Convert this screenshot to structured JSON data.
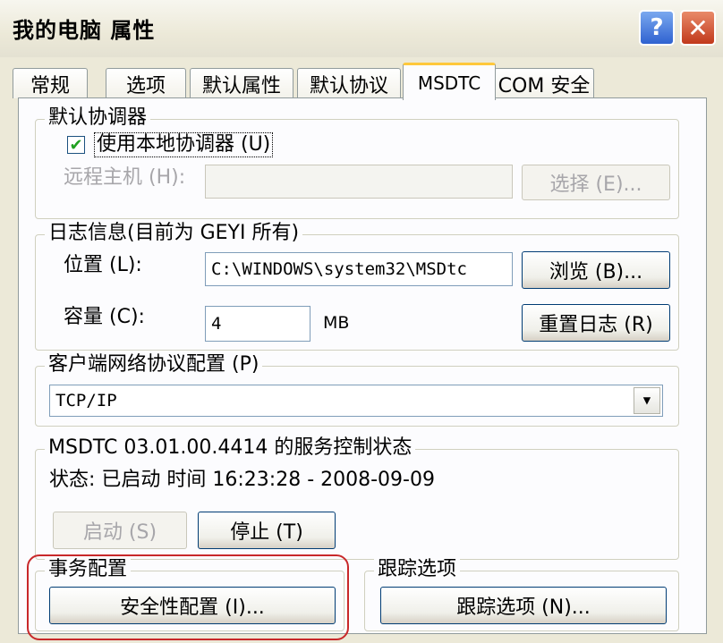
{
  "window": {
    "title": "我的电脑 属性",
    "help_glyph": "?",
    "close_glyph": "✕"
  },
  "tabs": [
    {
      "label": "常规"
    },
    {
      "label": "选项"
    },
    {
      "label": "默认属性"
    },
    {
      "label": "默认协议"
    },
    {
      "label": "MSDTC"
    },
    {
      "label": "COM 安全"
    }
  ],
  "coordinator": {
    "legend": "默认协调器",
    "use_local_label": "使用本地协调器 (U)",
    "use_local_checked": true,
    "remote_host_label": "远程主机 (H):",
    "remote_host_value": "",
    "select_button": "选择 (E)..."
  },
  "log": {
    "legend": "日志信息(目前为 GEYI 所有)",
    "location_label": "位置 (L):",
    "location_value": "C:\\WINDOWS\\system32\\MSDtc",
    "browse_button": "浏览 (B)...",
    "capacity_label": "容量 (C):",
    "capacity_value": "4",
    "capacity_unit": "MB",
    "reset_button": "重置日志 (R)"
  },
  "client_protocol": {
    "legend": "客户端网络协议配置 (P)",
    "selected": "TCP/IP"
  },
  "service": {
    "legend": "MSDTC 03.01.00.4414 的服务控制状态",
    "status_text": "状态: 已启动 时间 16:23:28 - 2008-09-09",
    "start_button": "启动 (S)",
    "stop_button": "停止 (T)"
  },
  "transaction": {
    "legend": "事务配置",
    "security_button": "安全性配置 (I)..."
  },
  "tracing": {
    "legend": "跟踪选项",
    "tracing_button": "跟踪选项 (N)..."
  },
  "colors": {
    "highlight": "#c8282a",
    "tab_accent": "#ffc83c"
  }
}
